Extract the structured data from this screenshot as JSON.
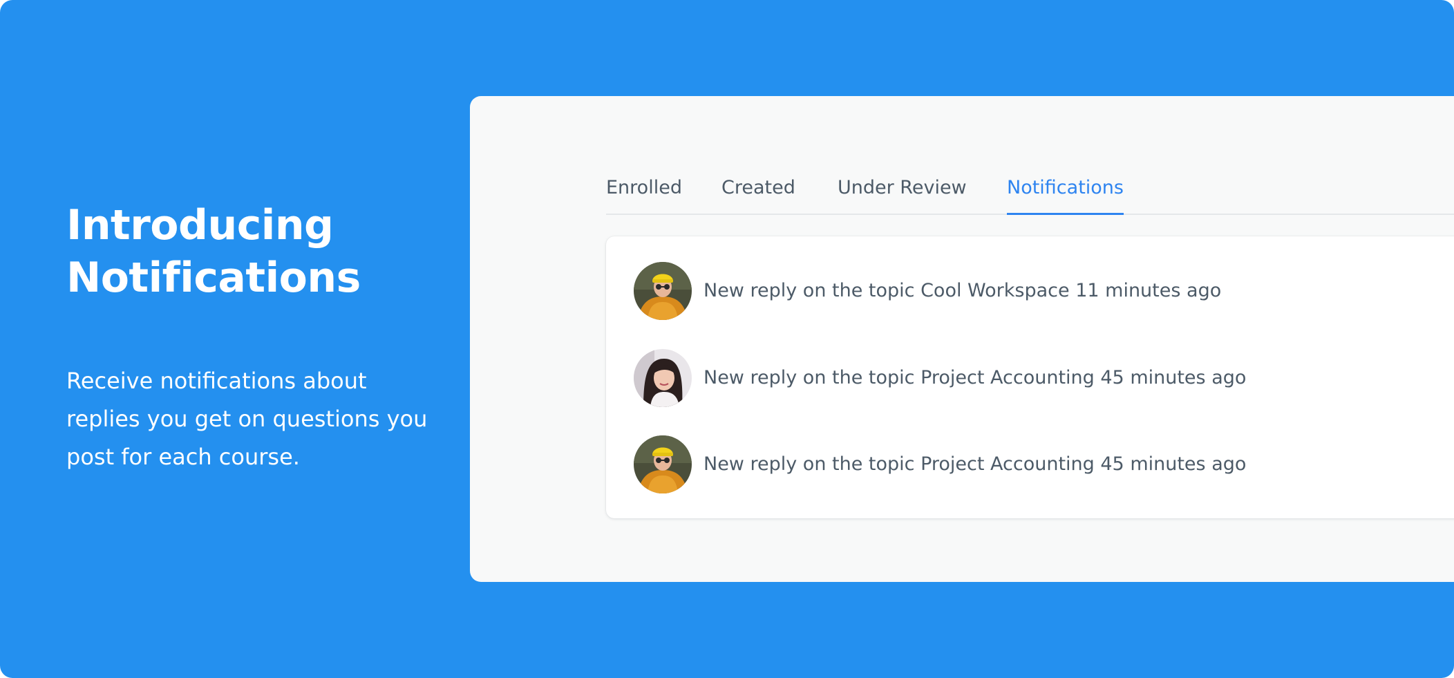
{
  "intro": {
    "title_line1": "Introducing",
    "title_line2": "Notifications",
    "desc_line1": "Receive notifications about",
    "desc_line2": "replies you get on questions you",
    "desc_line3": "post for each course."
  },
  "tabs": [
    {
      "label": "Enrolled",
      "active": false
    },
    {
      "label": "Created",
      "active": false
    },
    {
      "label": "Under Review",
      "active": false
    },
    {
      "label": "Notifications",
      "active": true
    }
  ],
  "notifications": [
    {
      "text": "New reply on the topic Cool Workspace 11 minutes ago",
      "avatar": "user-avatar-yellow-beanie"
    },
    {
      "text": "New reply on the topic Project Accounting 45 minutes ago",
      "avatar": "user-avatar-dark-hair"
    },
    {
      "text": "New reply on the topic Project Accounting 45 minutes ago",
      "avatar": "user-avatar-yellow-beanie"
    }
  ],
  "colors": {
    "background": "#2490EF",
    "panel": "#F8F9F9",
    "active_tab": "#2E84F0",
    "text": "#4C5A67"
  }
}
